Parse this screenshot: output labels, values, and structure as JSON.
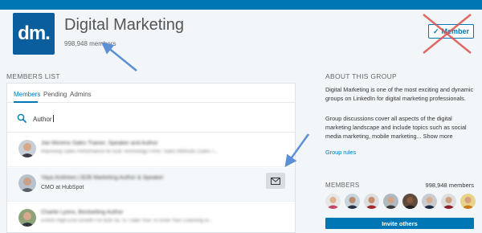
{
  "group": {
    "logo_text": "dm.",
    "title": "Digital Marketing",
    "member_count": "998,948 members",
    "member_button": "Member"
  },
  "members_list": {
    "section_label": "MEMBERS LIST",
    "tabs": [
      {
        "label": "Members",
        "active": true
      },
      {
        "label": "Pending",
        "active": false
      },
      {
        "label": "Admins",
        "active": false
      }
    ],
    "search_value": "Author",
    "rows": [
      {
        "name": "Joe Moreno Sales Trainer, Speaker and Author",
        "subtitle": "Improving Sales Performance for B2B Technology Firms: Sales Methods (Sales T...",
        "subtitle_clear": false
      },
      {
        "name": "Yaya Andrews | B2B Marketing Author & Speaker",
        "subtitle": "CMO at HubSpot",
        "subtitle_clear": true
      },
      {
        "name": "Charlie Lyons, Bestselling Author",
        "subtitle": "Enlists High-End Growth For B2B SE To Trade Your To Grow Your Coaching or...",
        "subtitle_clear": false
      }
    ]
  },
  "about": {
    "section_label": "ABOUT THIS GROUP",
    "para1": "Digital Marketing is one of the most exciting and dynamic groups on LinkedIn for digital marketing professionals.",
    "para2": "Group discussions cover all aspects of the digital marketing landscape and include topics such as social media marketing, mobile marketing...",
    "show_more": "Show more",
    "rules_link": "Group rules"
  },
  "members_panel": {
    "label": "MEMBERS",
    "count": "998,948 members",
    "invite_label": "Invite others"
  },
  "colors": {
    "brand_blue": "#0077b5",
    "annotation_arrow": "#5b8fd6",
    "annotation_cross": "#d9534f"
  }
}
